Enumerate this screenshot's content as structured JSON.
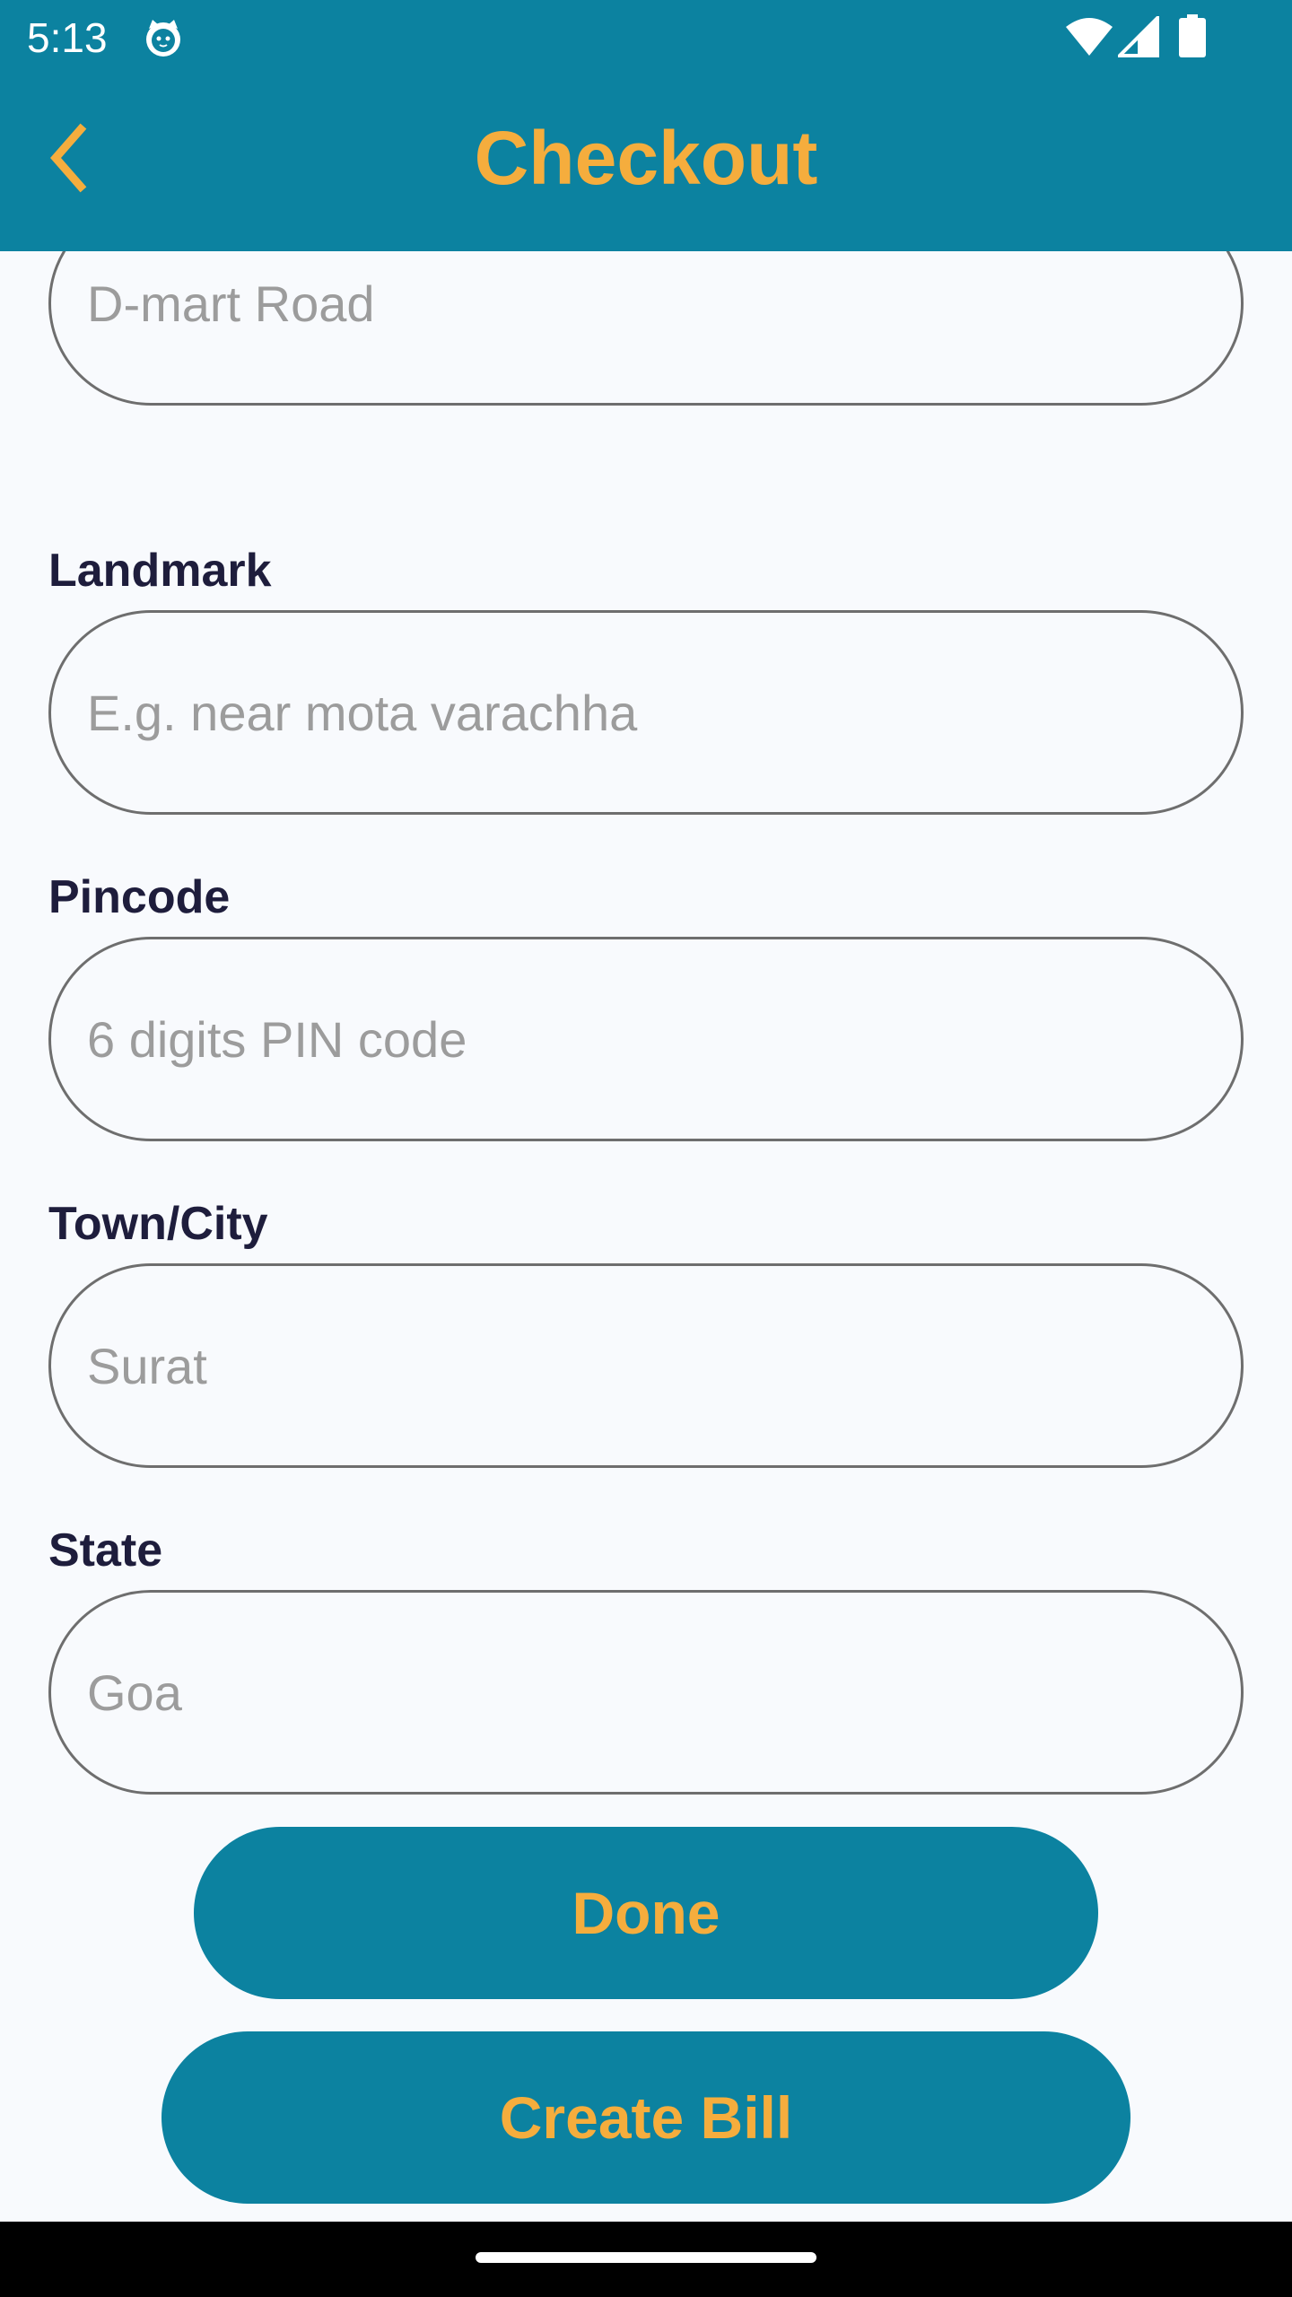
{
  "status_bar": {
    "time": "5:13",
    "app_icon": "cat-face-icon",
    "icons": [
      "wifi-icon",
      "signal-icon",
      "battery-icon"
    ]
  },
  "app_bar": {
    "title": "Checkout",
    "back_icon": "chevron-left-icon"
  },
  "form": {
    "street": {
      "placeholder": "D-mart Road"
    },
    "landmark": {
      "label": "Landmark",
      "placeholder": "E.g. near mota varachha"
    },
    "pincode": {
      "label": "Pincode",
      "placeholder": "6 digits PIN code"
    },
    "city": {
      "label": "Town/City",
      "placeholder": "Surat"
    },
    "state": {
      "label": "State",
      "placeholder": "Goa"
    }
  },
  "buttons": {
    "done": "Done",
    "create_bill": "Create Bill"
  },
  "colors": {
    "primary": "#0c82a0",
    "accent": "#f5ad3d",
    "label": "#1e1d3c",
    "background": "#f8fafd"
  }
}
